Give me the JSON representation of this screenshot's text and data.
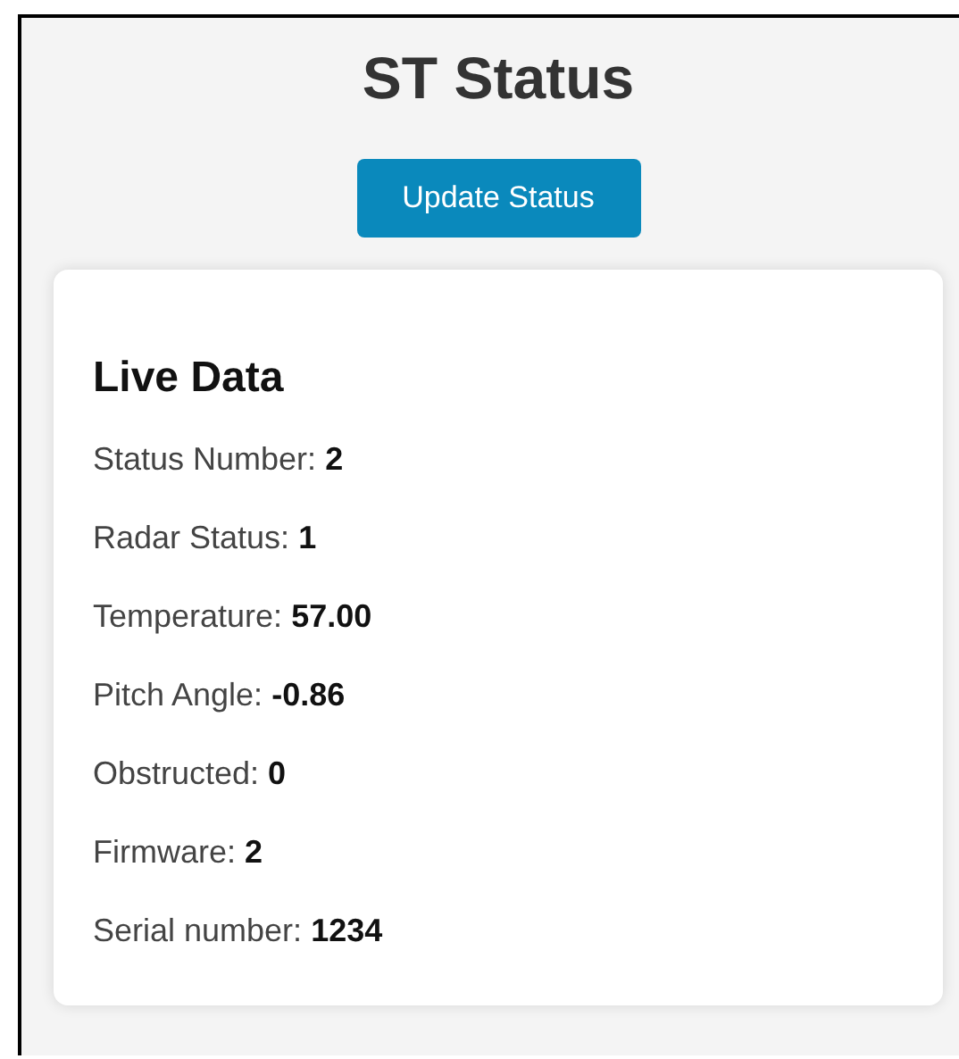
{
  "title": "ST Status",
  "update_button": "Update Status",
  "live_data": {
    "heading": "Live Data",
    "fields": [
      "Status Number: **2**",
      "Radar Status: **1**",
      "Temperature: **57.00**",
      "Pitch Angle: **-0.86**",
      "Obstructed: **0**",
      "Firmware: **2**",
      "Serial number: **1234**"
    ]
  }
}
